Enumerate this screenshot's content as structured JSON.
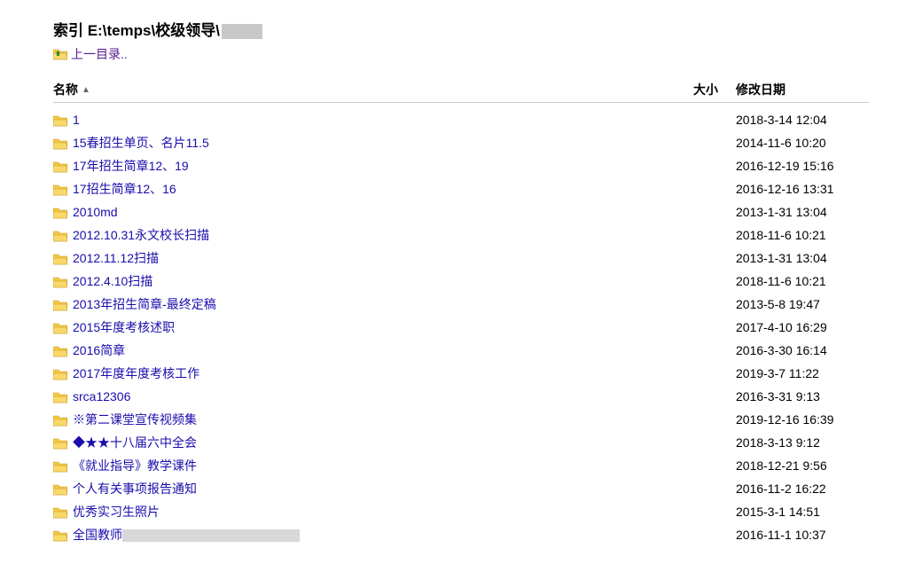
{
  "header": {
    "title_prefix": "索引 E:\\temps\\校级领导\\",
    "up_label": "上一目录.."
  },
  "columns": {
    "name": "名称",
    "size": "大小",
    "date": "修改日期"
  },
  "items": [
    {
      "name": "1",
      "size": "",
      "date": "2018-3-14 12:04"
    },
    {
      "name": "15春招生单页、名片11.5",
      "size": "",
      "date": "2014-11-6 10:20"
    },
    {
      "name": "17年招生简章12、19",
      "size": "",
      "date": "2016-12-19 15:16"
    },
    {
      "name": "17招生简章12、16",
      "size": "",
      "date": "2016-12-16 13:31"
    },
    {
      "name": "2010md",
      "size": "",
      "date": "2013-1-31 13:04"
    },
    {
      "name": "2012.10.31永文校长扫描",
      "size": "",
      "date": "2018-11-6 10:21"
    },
    {
      "name": "2012.11.12扫描",
      "size": "",
      "date": "2013-1-31 13:04"
    },
    {
      "name": "2012.4.10扫描",
      "size": "",
      "date": "2018-11-6 10:21"
    },
    {
      "name": "2013年招生简章-最终定稿",
      "size": "",
      "date": "2013-5-8 19:47"
    },
    {
      "name": "2015年度考核述职",
      "size": "",
      "date": "2017-4-10 16:29"
    },
    {
      "name": "2016简章",
      "size": "",
      "date": "2016-3-30 16:14"
    },
    {
      "name": "2017年度年度考核工作",
      "size": "",
      "date": "2019-3-7 11:22"
    },
    {
      "name": "srca12306",
      "size": "",
      "date": "2016-3-31 9:13"
    },
    {
      "name": "※第二课堂宣传视频集",
      "size": "",
      "date": "2019-12-16 16:39"
    },
    {
      "name": "◆★★十八届六中全会",
      "size": "",
      "date": "2018-3-13 9:12"
    },
    {
      "name": "《就业指导》教学课件",
      "size": "",
      "date": "2018-12-21 9:56"
    },
    {
      "name": "个人有关事项报告通知",
      "size": "",
      "date": "2016-11-2 16:22"
    },
    {
      "name": "优秀实习生照片",
      "size": "",
      "date": "2015-3-1 14:51"
    },
    {
      "name": "全国教师",
      "size": "",
      "date": "2016-11-1 10:37",
      "truncated": true
    }
  ]
}
